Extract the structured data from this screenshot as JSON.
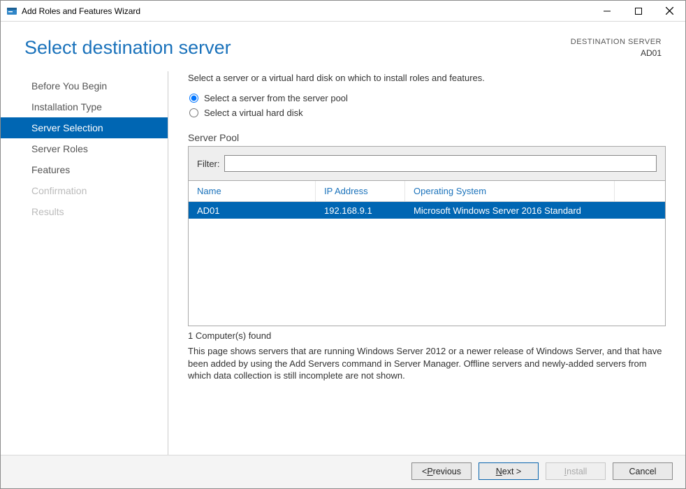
{
  "window": {
    "title": "Add Roles and Features Wizard"
  },
  "header": {
    "page_title": "Select destination server",
    "destination_label": "DESTINATION SERVER",
    "destination_name": "AD01"
  },
  "sidebar": {
    "items": [
      {
        "label": "Before You Begin",
        "state": "normal"
      },
      {
        "label": "Installation Type",
        "state": "normal"
      },
      {
        "label": "Server Selection",
        "state": "selected"
      },
      {
        "label": "Server Roles",
        "state": "normal"
      },
      {
        "label": "Features",
        "state": "normal"
      },
      {
        "label": "Confirmation",
        "state": "disabled"
      },
      {
        "label": "Results",
        "state": "disabled"
      }
    ]
  },
  "main": {
    "instruction": "Select a server or a virtual hard disk on which to install roles and features.",
    "radios": {
      "pool": "Select a server from the server pool",
      "vhd": "Select a virtual hard disk",
      "selected": "pool"
    },
    "server_pool_label": "Server Pool",
    "filter_label": "Filter:",
    "filter_value": "",
    "columns": {
      "name": "Name",
      "ip": "IP Address",
      "os": "Operating System"
    },
    "rows": [
      {
        "name": "AD01",
        "ip": "192.168.9.1",
        "os": "Microsoft Windows Server 2016 Standard"
      }
    ],
    "found_text": "1 Computer(s) found",
    "info_text": "This page shows servers that are running Windows Server 2012 or a newer release of Windows Server, and that have been added by using the Add Servers command in Server Manager. Offline servers and newly-added servers from which data collection is still incomplete are not shown."
  },
  "footer": {
    "previous_pre": "< ",
    "previous_ul": "P",
    "previous_post": "revious",
    "next_ul": "N",
    "next_post": "ext >",
    "install_ul": "I",
    "install_post": "nstall",
    "cancel": "Cancel"
  }
}
